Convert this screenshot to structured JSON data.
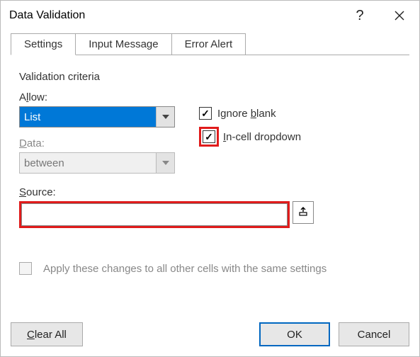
{
  "window": {
    "title": "Data Validation"
  },
  "tabs": {
    "settings": "Settings",
    "input_message": "Input Message",
    "error_alert": "Error Alert",
    "active": "settings"
  },
  "group": {
    "label": "Validation criteria"
  },
  "allow": {
    "label_pre": "A",
    "label_u": "l",
    "label_post": "low:",
    "value": "List"
  },
  "data": {
    "label_pre": "",
    "label_u": "D",
    "label_post": "ata:",
    "value": "between"
  },
  "checkboxes": {
    "ignore_blank": {
      "pre": "Ignore ",
      "u": "b",
      "post": "lank",
      "checked": true
    },
    "incell_dropdown": {
      "pre": "",
      "u": "I",
      "post": "n-cell dropdown",
      "checked": true
    }
  },
  "source": {
    "label_pre": "",
    "label_u": "S",
    "label_post": "ource:",
    "value": ""
  },
  "apply": {
    "label_pre": "Apply these changes to all other cells with the same settings",
    "u": "P",
    "text": "Apply these changes to all other cells with the same settings",
    "checked": false
  },
  "buttons": {
    "clear_all_pre": "",
    "clear_all_u": "C",
    "clear_all_post": "lear All",
    "ok": "OK",
    "cancel": "Cancel"
  }
}
